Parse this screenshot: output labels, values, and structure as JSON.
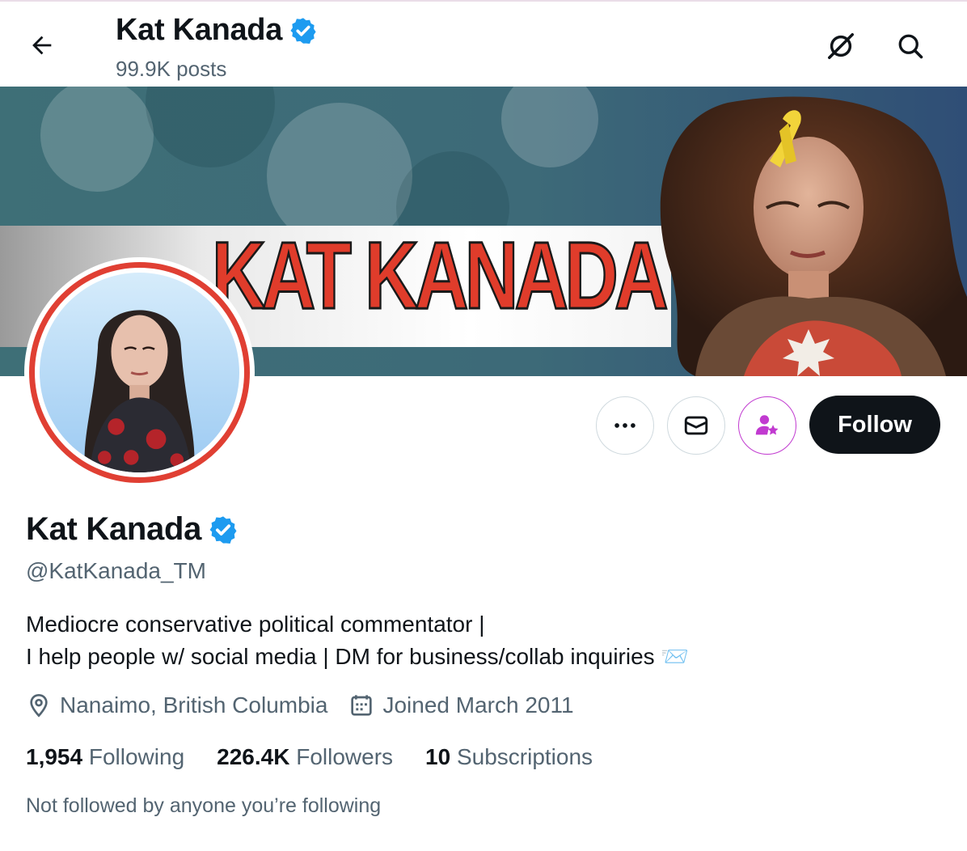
{
  "header": {
    "name": "Kat Kanada",
    "posts": "99.9K posts",
    "back_icon": "arrow-left-icon",
    "grok_icon": "grok-icon",
    "search_icon": "search-icon"
  },
  "banner": {
    "title": "KAT KANADA"
  },
  "actions": {
    "more_icon": "more-dots-icon",
    "message_icon": "envelope-icon",
    "subscribe_icon": "subscribe-star-icon",
    "follow_label": "Follow"
  },
  "profile": {
    "name": "Kat Kanada",
    "handle": "@KatKanada_TM",
    "bio_line1": "Mediocre conservative political commentator |",
    "bio_line2": "I help people w/ social media | DM for business/collab inquiries 📨",
    "location": "Nanaimo, British Columbia",
    "joined": "Joined March 2011",
    "note": "Not followed by anyone you’re following"
  },
  "stats": {
    "following_count": "1,954",
    "following_label": "Following",
    "followers_count": "226.4K",
    "followers_label": "Followers",
    "subscriptions_count": "10",
    "subscriptions_label": "Subscriptions"
  },
  "colors": {
    "verified": "#1d9bf0",
    "follow_bg": "#0f1419",
    "subscribe_accent": "#c13ad0",
    "avatar_ring": "#e03f33",
    "banner_text": "#e03c2b"
  }
}
